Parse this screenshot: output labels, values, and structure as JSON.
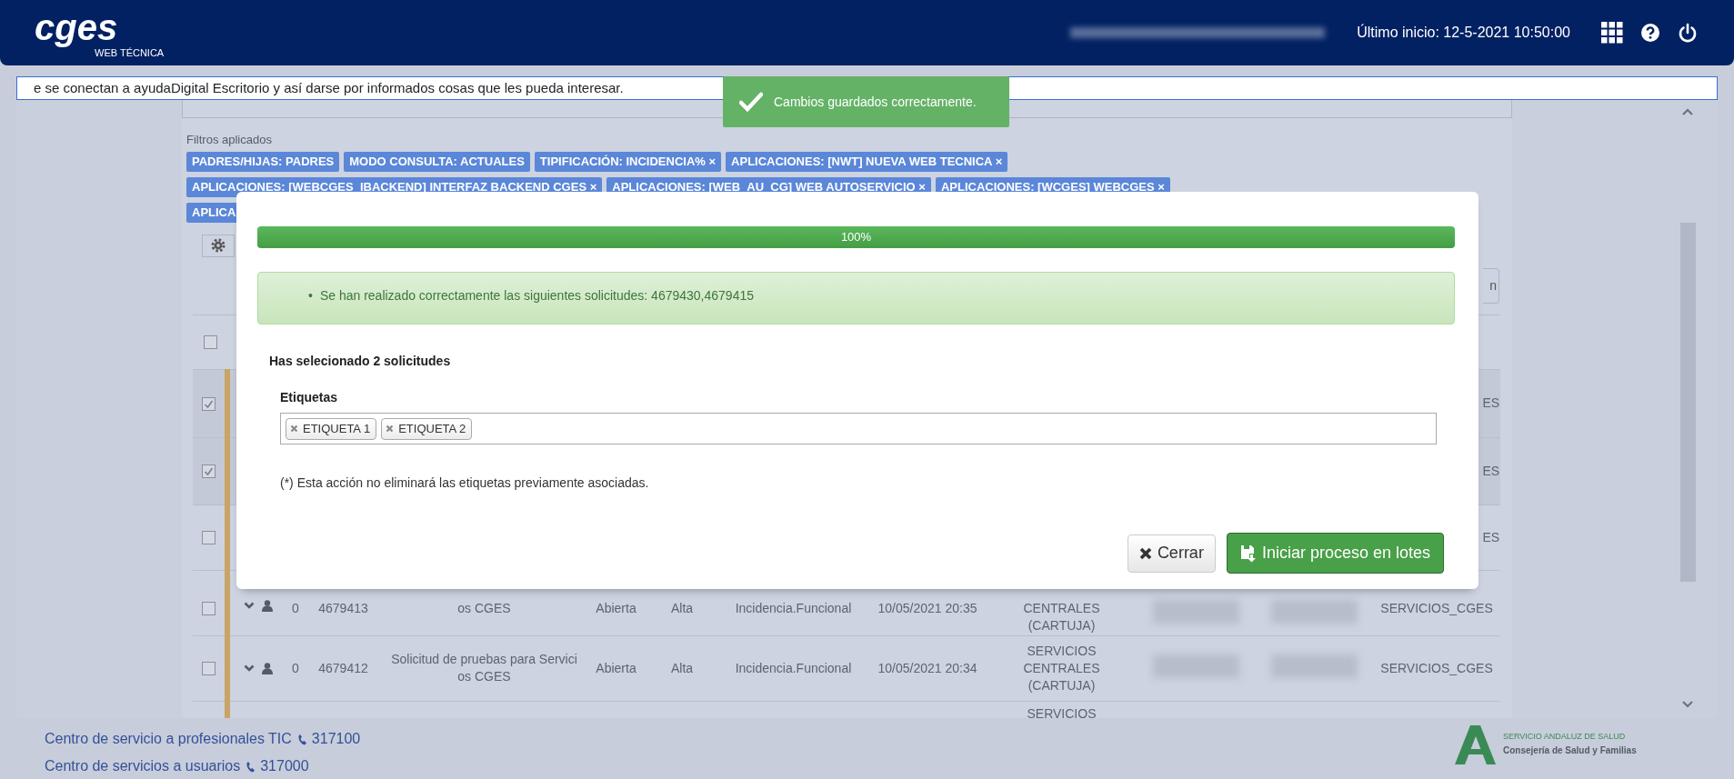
{
  "header": {
    "logo": "cges",
    "logo_subtitle": "WEB TÉCNICA",
    "last_login": "Último inicio: 12-5-2021 10:50:00"
  },
  "announcement": "e se conectan a ayudaDigital Escritorio y así darse por informados cosas que les pueda interesar.",
  "toast": {
    "message": "Cambios guardados correctamente."
  },
  "filters": {
    "label": "Filtros aplicados",
    "tag_rows": [
      [
        {
          "text": "PADRES/HIJAS: PADRES"
        },
        {
          "text": "MODO CONSULTA: ACTUALES"
        },
        {
          "text": "TIPIFICACIÓN: INCIDENCIA%",
          "remove": "×"
        },
        {
          "text": "APLICACIONES: [NWT] NUEVA WEB TECNICA",
          "remove": "×"
        }
      ],
      [
        {
          "text": "APLICACIONES: [WEBCGES_IBACKEND] INTERFAZ BACKEND CGES",
          "remove": "×"
        },
        {
          "text": "APLICACIONES: [WEB_AU_CG] WEB AUTOSERVICIO",
          "remove": "×"
        },
        {
          "text": "APLICACIONES: [WCGES] WEBCGES",
          "remove": "×"
        }
      ],
      [
        {
          "text": "APLICA"
        }
      ]
    ]
  },
  "toolbar": {
    "button_fragment": "n"
  },
  "table": {
    "header": {
      "checked": false
    },
    "rows": [
      {
        "kind": "covered",
        "checked": true,
        "group": "ES"
      },
      {
        "kind": "covered",
        "checked": true,
        "group": "ES"
      },
      {
        "kind": "covered",
        "checked": false,
        "group": "ES"
      },
      {
        "kind": "full",
        "checked": false,
        "count": "0",
        "id": "4679413",
        "description": [
          "os CGES"
        ],
        "status": "Abierta",
        "priority": "Alta",
        "type": "Incidencia.Funcional",
        "date": "10/05/2021 20:35",
        "center": [
          "CENTRALES",
          "(CARTUJA)"
        ],
        "group": "SERVICIOS_CGES"
      },
      {
        "kind": "full",
        "checked": false,
        "count": "0",
        "id": "4679412",
        "description": [
          "Solicitud de pruebas para Servici",
          "os CGES"
        ],
        "status": "Abierta",
        "priority": "Alta",
        "type": "Incidencia.Funcional",
        "date": "10/05/2021 20:34",
        "center": [
          "SERVICIOS",
          "CENTRALES",
          "(CARTUJA)"
        ],
        "group": "SERVICIOS_CGES"
      },
      {
        "kind": "partial",
        "center": [
          "SERVICIOS"
        ]
      }
    ]
  },
  "modal": {
    "progress": {
      "level": 1,
      "label": "100%"
    },
    "alert": {
      "marker": "•",
      "items": [
        "Se han realizado correctamente las siguientes solicitudes: 4679430,4679415"
      ]
    },
    "selection_summary": "Has selecionado 2 solicitudes",
    "tags_field": {
      "label": "Etiquetas",
      "tags": [
        "ETIQUETA 1",
        "ETIQUETA 2"
      ]
    },
    "note": "(*) Esta acción no eliminará las etiquetas previamente asociadas.",
    "buttons": [
      {
        "label": "Cerrar",
        "kind": "close"
      },
      {
        "label": "Iniciar proceso en lotes",
        "kind": "submit"
      }
    ]
  },
  "footer": {
    "contacts": [
      {
        "label": "Centro de servicio a profesionales TIC",
        "phone": "317100"
      },
      {
        "label": "Centro de servicios a usuarios",
        "phone": "317000"
      }
    ],
    "logo": {
      "line1": "SERVICIO ANDALUZ DE SALUD",
      "line2": "Consejería de Salud y Familias"
    }
  }
}
